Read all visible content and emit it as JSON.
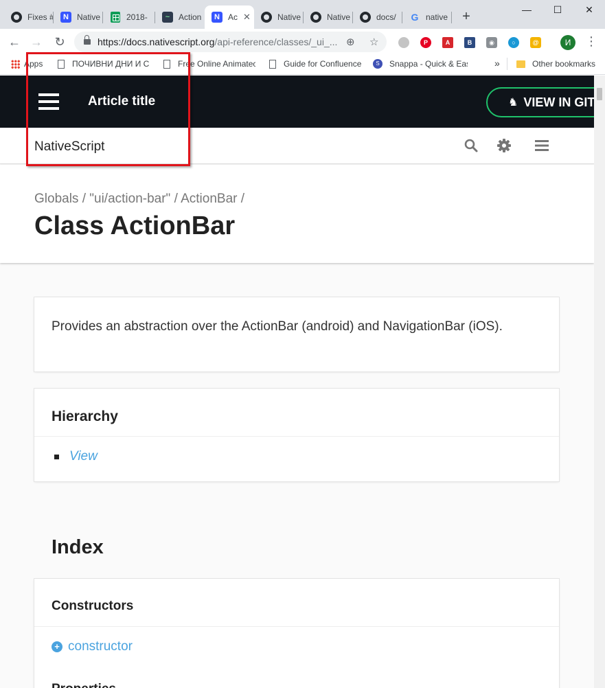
{
  "browser": {
    "tabs": [
      {
        "title": "Fixes #",
        "icon": "github-icon"
      },
      {
        "title": "Native",
        "icon": "nativescript-icon"
      },
      {
        "title": "2018-",
        "icon": "sheets-icon"
      },
      {
        "title": "Action",
        "icon": "actionbar-icon"
      },
      {
        "title": "Ac",
        "icon": "nativescript-icon",
        "active": true
      },
      {
        "title": "Native",
        "icon": "github-icon"
      },
      {
        "title": "Native",
        "icon": "github-icon"
      },
      {
        "title": "docs/",
        "icon": "github-icon"
      },
      {
        "title": "native",
        "icon": "google-icon"
      }
    ],
    "url_domain": "https://docs.nativescript.org",
    "url_rest": "/api-reference/classes/_ui_...",
    "profile_initial": "И",
    "bookmarks": [
      {
        "label": "Apps",
        "icon": "apps-grid-icon"
      },
      {
        "label": "ПОЧИВНИ ДНИ И С",
        "icon": "page-icon"
      },
      {
        "label": "Free Online Animatec",
        "icon": "page-icon"
      },
      {
        "label": "Guide for Confluence",
        "icon": "page-icon"
      },
      {
        "label": "Snappa - Quick & Eas",
        "icon": "snappa-icon"
      }
    ],
    "other_bookmarks": "Other bookmarks",
    "overflow": "»"
  },
  "site": {
    "article_title": "Article title",
    "view_on_github": "VIEW IN GIT",
    "brand": "NativeScript",
    "breadcrumb": "Globals / \"ui/action-bar\" / ActionBar /",
    "page_title": "Class ActionBar",
    "description": "Provides an abstraction over the ActionBar (android) and NavigationBar (iOS).",
    "hierarchy_heading": "Hierarchy",
    "hierarchy_item": "View",
    "index_heading": "Index",
    "constructors_heading": "Constructors",
    "constructor_link": "constructor",
    "properties_heading": "Properties"
  },
  "colors": {
    "topbar": "#0f141a",
    "accent_green": "#1fc26b",
    "link_blue": "#4aa3df",
    "highlight_red": "#e0141b"
  }
}
